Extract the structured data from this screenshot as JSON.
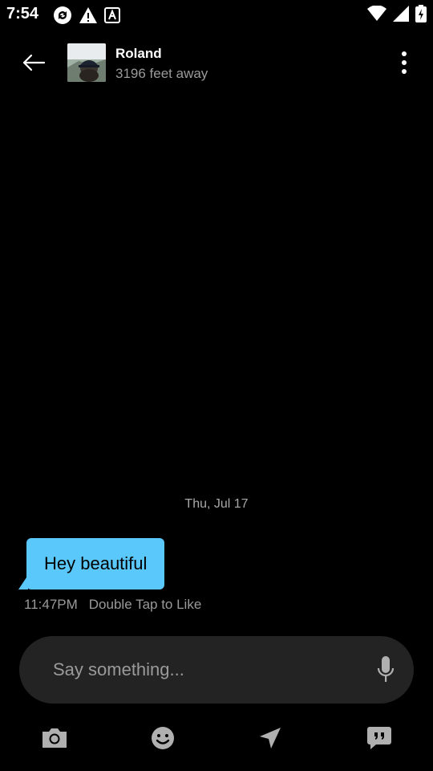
{
  "status_bar": {
    "time": "7:54"
  },
  "header": {
    "contact_name": "Roland",
    "distance": "3196 feet away"
  },
  "conversation": {
    "date_divider": "Thu, Jul 17",
    "messages": [
      {
        "text": "Hey beautiful",
        "time": "11:47PM",
        "like_hint": "Double Tap to Like"
      }
    ]
  },
  "composer": {
    "placeholder": "Say something..."
  },
  "toolbar": {
    "icons": [
      "camera-icon",
      "emoji-icon",
      "location-icon",
      "saved-phrases-icon"
    ]
  },
  "colors": {
    "background": "#000000",
    "bubble": "#5ac8fa",
    "composer": "#232323",
    "secondary_text": "#9a9a9a",
    "icon_gray": "#b0b0b0"
  }
}
